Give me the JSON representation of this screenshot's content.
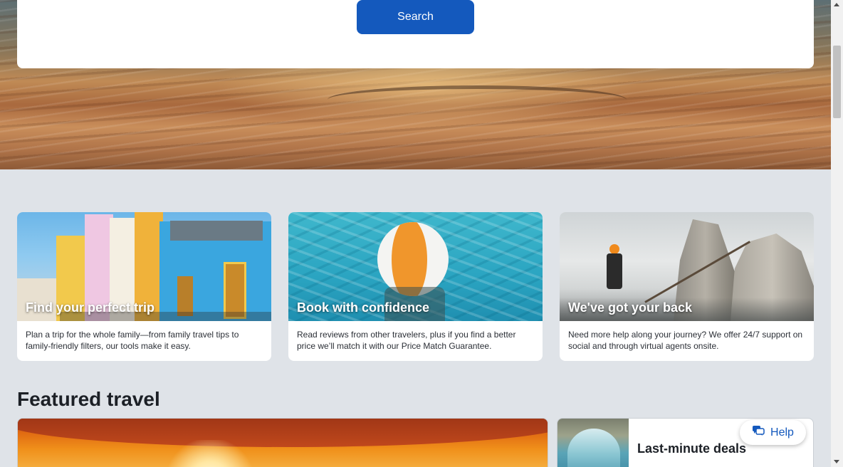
{
  "search": {
    "button_label": "Search"
  },
  "value_cards": [
    {
      "title": "Find your perfect trip",
      "description": "Plan a trip for the whole family—from family travel tips to family-friendly filters, our tools make it easy."
    },
    {
      "title": "Book with confidence",
      "description": "Read reviews from other travelers, plus if you find a better price we’ll match it with our Price Match Guarantee."
    },
    {
      "title": "We've got your back",
      "description": "Need more help along your journey? We offer 24/7 support on social and through virtual agents onsite."
    }
  ],
  "featured": {
    "section_title": "Featured travel",
    "side_card_label": "Last-minute deals"
  },
  "help": {
    "label": "Help",
    "icon": "chat-bubbles-icon"
  },
  "colors": {
    "primary": "#1459bd",
    "page_bg": "#dfe3e8",
    "card_bg": "#ffffff",
    "text": "#1c2026"
  }
}
